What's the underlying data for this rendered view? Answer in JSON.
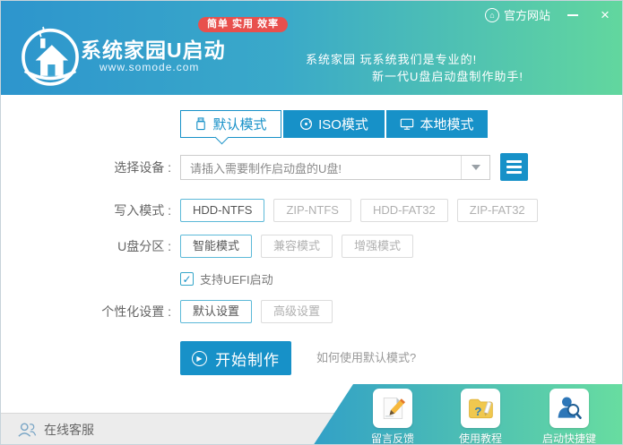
{
  "titlebar": {
    "official_site": "官方网站",
    "close_glyph": "×",
    "site_icon_glyph": "⌂"
  },
  "header": {
    "title": "系统家园U启动",
    "url": "www.somode.com",
    "badge": "简单 实用 效率",
    "slogan1": "系统家园 玩系统我们是专业的!",
    "slogan2": "新一代U盘启动盘制作助手!"
  },
  "tabs": [
    {
      "label": "默认模式",
      "icon": "usb-icon",
      "active": true
    },
    {
      "label": "ISO模式",
      "icon": "disc-icon",
      "active": false
    },
    {
      "label": "本地模式",
      "icon": "monitor-icon",
      "active": false
    }
  ],
  "form": {
    "device": {
      "label": "选择设备 :",
      "value": "请插入需要制作启动盘的U盘!"
    },
    "write_mode": {
      "label": "写入模式 :",
      "options": [
        "HDD-NTFS",
        "ZIP-NTFS",
        "HDD-FAT32",
        "ZIP-FAT32"
      ],
      "selected": "HDD-NTFS"
    },
    "partition": {
      "label": "U盘分区 :",
      "options": [
        "智能模式",
        "兼容模式",
        "增强模式"
      ],
      "selected": "智能模式"
    },
    "uefi": {
      "label": "支持UEFI启动",
      "checked": true,
      "check_glyph": "✓"
    },
    "personalize": {
      "label": "个性化设置 :",
      "options": [
        "默认设置",
        "高级设置"
      ],
      "selected": "默认设置"
    },
    "start_button": {
      "label": "开始制作",
      "play_glyph": "▶"
    },
    "help_link": {
      "label": "如何使用默认模式?"
    }
  },
  "footer": {
    "service": {
      "label": "在线客服",
      "icon": "customer-service-icon"
    },
    "shortcuts": [
      {
        "label": "留言反馈",
        "icon": "feedback-pencil-icon"
      },
      {
        "label": "使用教程",
        "icon": "tutorial-folder-icon"
      },
      {
        "label": "启动快捷键",
        "icon": "hotkey-search-icon"
      }
    ]
  },
  "colors": {
    "accent_blue": "#1791c8",
    "header_gradient_start": "#2d95cd",
    "header_gradient_end": "#62d79e",
    "badge_red": "#e8504d"
  }
}
